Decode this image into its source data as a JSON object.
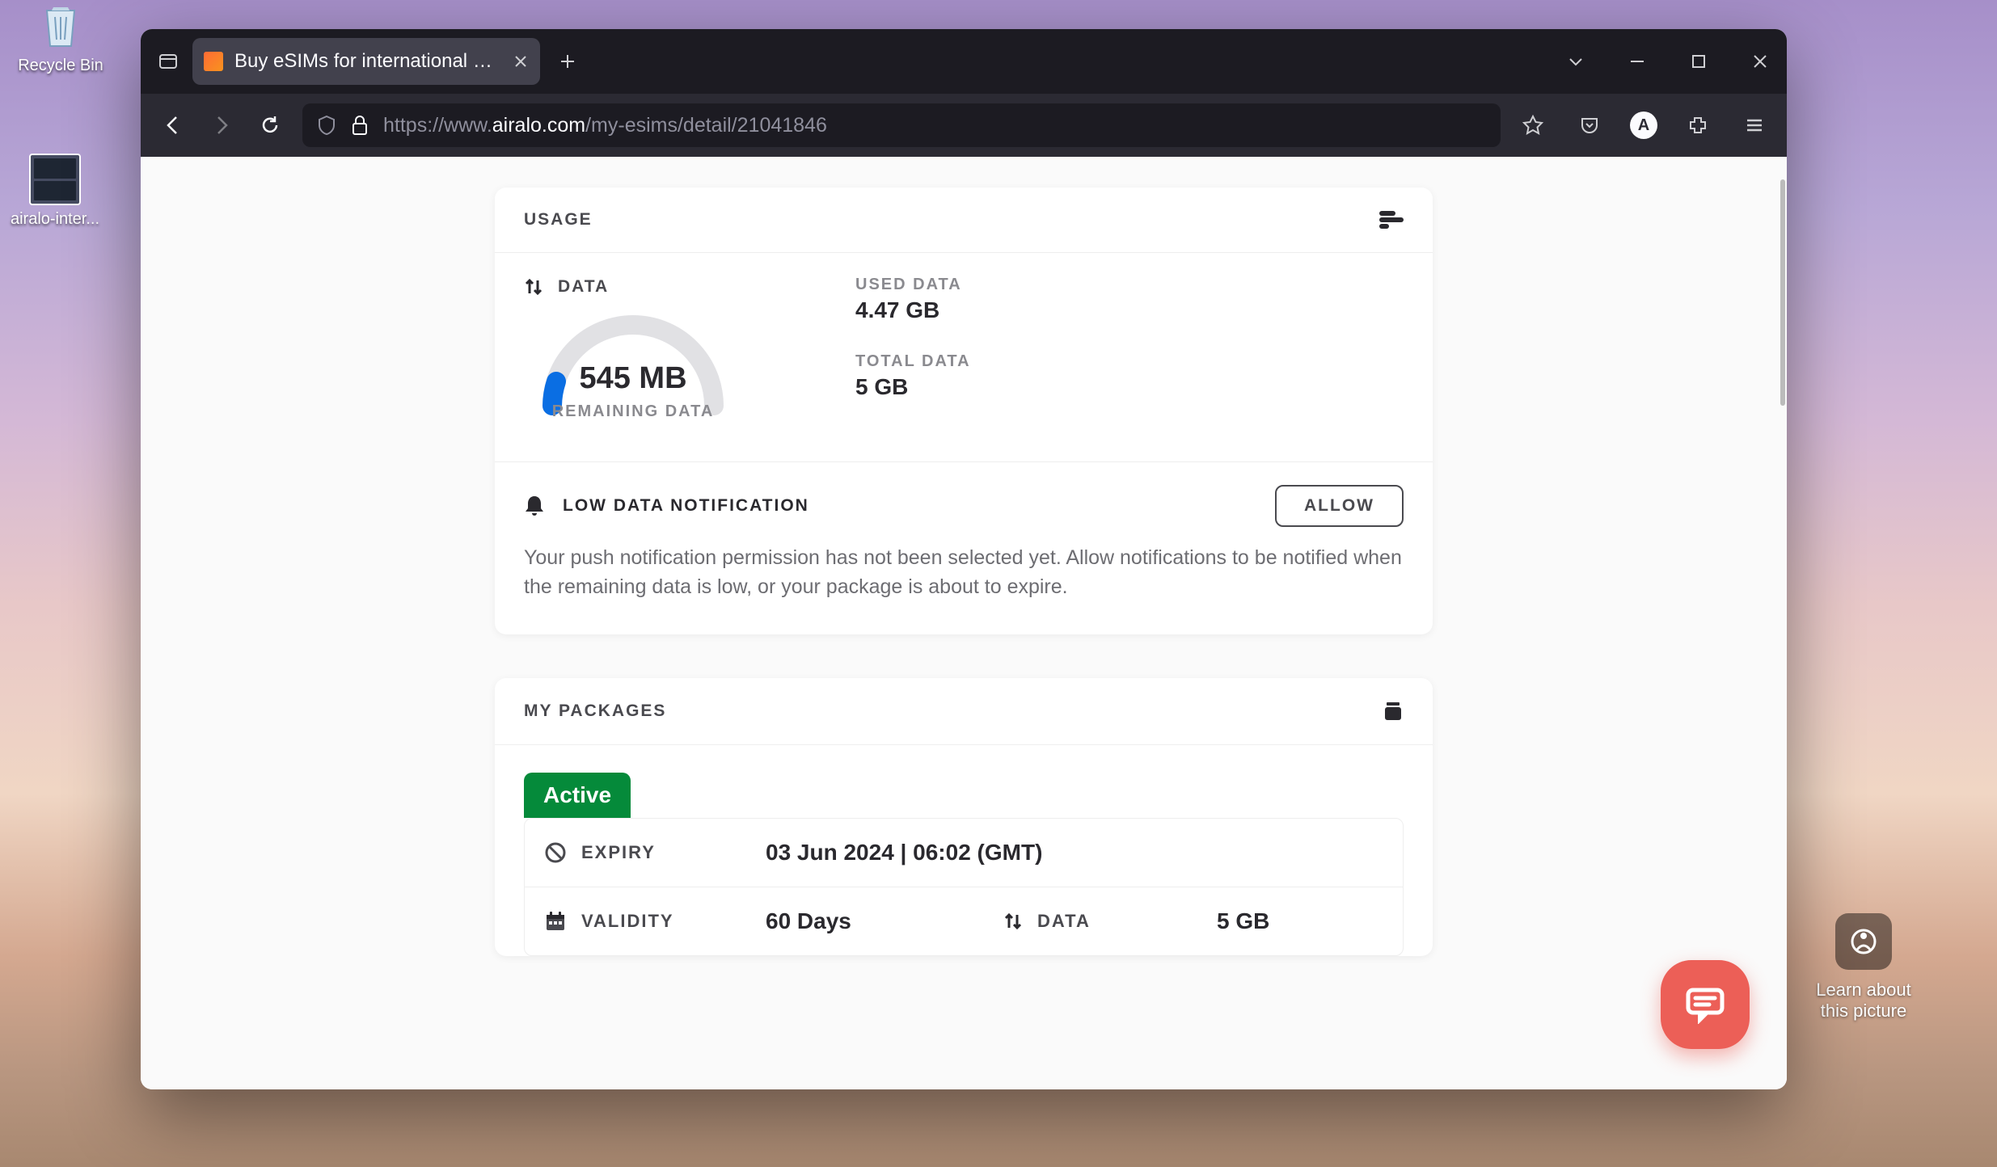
{
  "desktop": {
    "recycle_label": "Recycle Bin",
    "file_label": "airalo-inter...",
    "learn_line1": "Learn about",
    "learn_line2": "this picture"
  },
  "browser": {
    "tab_title": "Buy eSIMs for international trav",
    "url_prefix": "https://www.",
    "url_domain": "airalo.com",
    "url_path": "/my-esims/detail/21041846"
  },
  "usage": {
    "title": "USAGE",
    "data_label": "DATA",
    "remaining_value": "545 MB",
    "remaining_label": "REMAINING DATA",
    "used_label": "USED DATA",
    "used_value": "4.47 GB",
    "total_label": "TOTAL DATA",
    "total_value": "5 GB"
  },
  "notification": {
    "title": "LOW DATA NOTIFICATION",
    "allow": "ALLOW",
    "text": "Your push notification permission has not been selected yet. Allow notifications to be notified when the remaining data is low, or your package is about to expire."
  },
  "packages": {
    "title": "MY PACKAGES",
    "status": "Active",
    "expiry_label": "EXPIRY",
    "expiry_value": "03 Jun 2024 | 06:02 (GMT)",
    "validity_label": "VALIDITY",
    "validity_value": "60 Days",
    "data_label": "DATA",
    "data_value": "5 GB"
  }
}
